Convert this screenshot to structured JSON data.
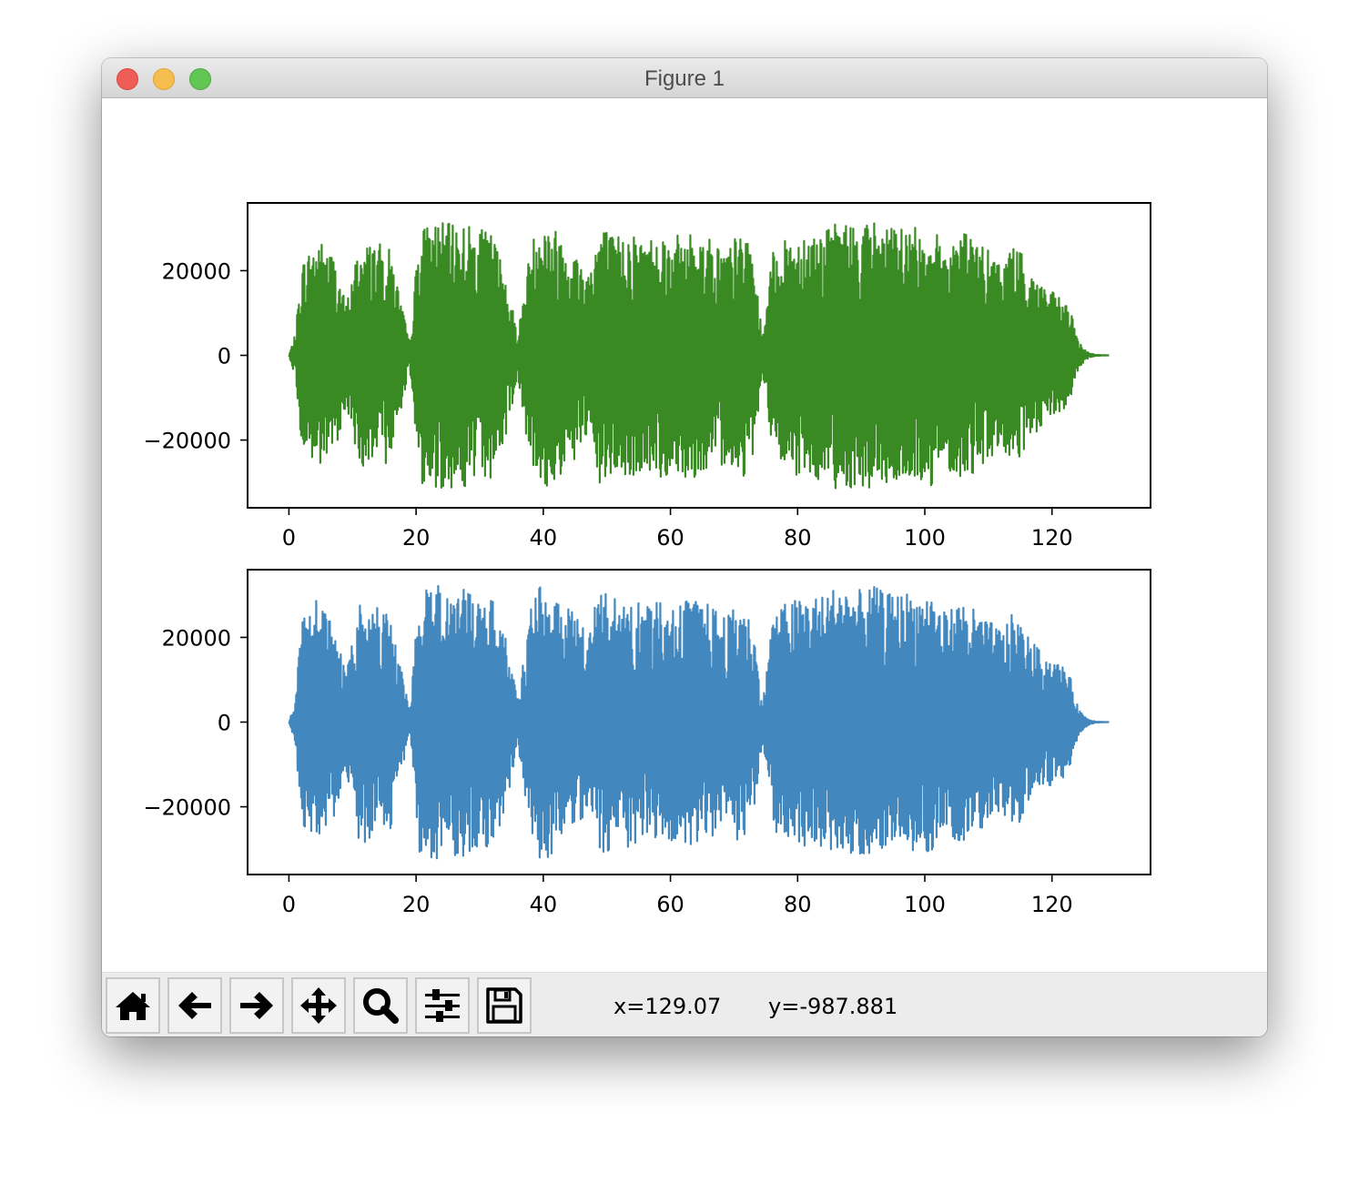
{
  "window": {
    "title": "Figure 1"
  },
  "toolbar": {
    "buttons": [
      {
        "name": "home",
        "icon": "home-icon"
      },
      {
        "name": "back",
        "icon": "arrow-left-icon"
      },
      {
        "name": "forward",
        "icon": "arrow-right-icon"
      },
      {
        "name": "pan",
        "icon": "move-arrows-icon"
      },
      {
        "name": "zoom",
        "icon": "magnifier-icon"
      },
      {
        "name": "configure-subplots",
        "icon": "sliders-icon"
      },
      {
        "name": "save",
        "icon": "floppy-disk-icon"
      }
    ],
    "x_readout": "x=129.07",
    "y_readout": "y=-987.881"
  },
  "chart_data": [
    {
      "type": "line",
      "color": "#3a8a24",
      "xlim": [
        -6.5,
        135.5
      ],
      "ylim": [
        -36000,
        36000
      ],
      "xticks": [
        0,
        20,
        40,
        60,
        80,
        100,
        120
      ],
      "xtick_labels": [
        "0",
        "20",
        "40",
        "60",
        "80",
        "100",
        "120"
      ],
      "yticks": [
        20000,
        0,
        -20000
      ],
      "ytick_labels": [
        "20000",
        "0",
        "−20000"
      ],
      "grid": false,
      "series": [
        {
          "x": [
            0,
            1,
            2,
            4.5,
            7,
            9,
            11,
            13.5,
            16,
            18,
            19,
            20.5,
            23,
            25,
            27,
            29.5,
            32,
            34,
            36,
            38,
            39.5,
            42,
            44,
            47,
            49,
            51,
            53.5,
            56,
            58,
            60,
            63,
            66,
            69,
            71,
            73,
            74.5,
            76,
            78,
            81,
            84,
            86.5,
            89,
            92,
            95,
            97,
            99,
            101,
            103,
            106,
            109,
            112,
            114,
            116,
            118,
            120,
            122,
            123,
            124,
            125,
            126,
            127,
            129
          ],
          "envelope": [
            0,
            5000,
            22000,
            28000,
            24000,
            12000,
            26000,
            27000,
            25000,
            10000,
            3000,
            30000,
            32000,
            31000,
            32000,
            30000,
            29000,
            20000,
            5000,
            26000,
            33000,
            30000,
            27000,
            20000,
            32000,
            28000,
            30000,
            27000,
            30000,
            28000,
            29000,
            28000,
            25000,
            30000,
            24000,
            4000,
            24000,
            27000,
            30000,
            29000,
            32000,
            31000,
            32000,
            30000,
            31000,
            30000,
            31000,
            26000,
            30000,
            26000,
            22000,
            27000,
            22000,
            18000,
            15000,
            13000,
            10000,
            4000,
            1500,
            500,
            100,
            0
          ]
        }
      ]
    },
    {
      "type": "line",
      "color": "#4287bd",
      "xlim": [
        -6.5,
        135.5
      ],
      "ylim": [
        -36000,
        36000
      ],
      "xticks": [
        0,
        20,
        40,
        60,
        80,
        100,
        120
      ],
      "xtick_labels": [
        "0",
        "20",
        "40",
        "60",
        "80",
        "100",
        "120"
      ],
      "yticks": [
        20000,
        0,
        -20000
      ],
      "ytick_labels": [
        "20000",
        "0",
        "−20000"
      ],
      "grid": false,
      "series": [
        {
          "x": [
            0,
            1,
            2,
            4.5,
            7,
            9,
            11,
            13.5,
            16,
            18,
            19,
            20.5,
            23,
            25,
            27,
            29.5,
            32,
            34,
            36,
            38,
            39.5,
            42,
            44,
            47,
            49,
            51,
            53.5,
            56,
            58,
            60,
            63,
            66,
            69,
            71,
            73,
            74.5,
            76,
            78,
            81,
            84,
            86.5,
            89,
            92,
            95,
            97,
            99,
            101,
            103,
            106,
            109,
            112,
            114,
            116,
            118,
            120,
            122,
            123,
            124,
            125,
            126,
            127,
            129
          ],
          "envelope": [
            0,
            5000,
            24000,
            29000,
            23000,
            11000,
            28000,
            29000,
            25000,
            10000,
            3000,
            31000,
            33000,
            31000,
            32000,
            31000,
            29000,
            21000,
            5000,
            27000,
            33000,
            31000,
            27000,
            21000,
            33000,
            29000,
            30000,
            27000,
            30000,
            28000,
            29000,
            28000,
            25000,
            29000,
            23000,
            4000,
            25000,
            28000,
            30000,
            30000,
            33000,
            31000,
            32000,
            30000,
            31000,
            30000,
            31000,
            26000,
            29000,
            25000,
            22000,
            26000,
            21000,
            17000,
            15000,
            13000,
            10000,
            4000,
            1500,
            500,
            100,
            0
          ]
        }
      ]
    }
  ]
}
